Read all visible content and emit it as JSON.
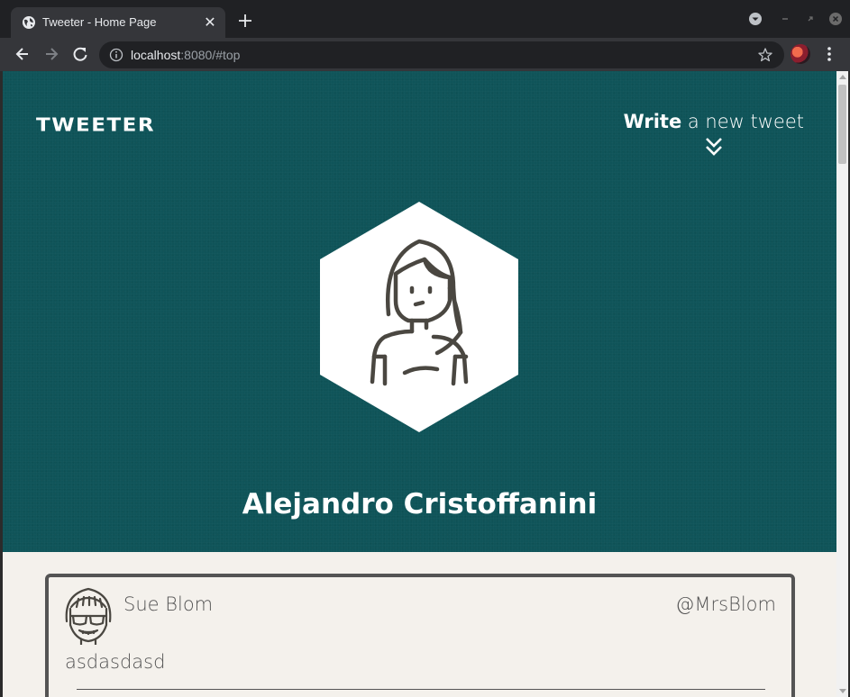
{
  "browser": {
    "tab_title": "Tweeter - Home Page",
    "url_host": "localhost",
    "url_rest": ":8080/#top"
  },
  "header": {
    "logo": "TWEETER",
    "compose_bold": "Write",
    "compose_rest": " a new tweet"
  },
  "profile": {
    "name": "Alejandro Cristoffanini"
  },
  "tweets": [
    {
      "name": "Sue Blom",
      "handle": "@MrsBlom",
      "text": "asdasdasd"
    }
  ],
  "colors": {
    "hero_bg": "#0f5459",
    "page_bg": "#f4f1ec",
    "text_dark": "#545454",
    "chrome_dark": "#202124",
    "chrome_tab": "#35363a"
  },
  "icons": {
    "tab": "globe-icon",
    "compose": "double-chevron-down-icon",
    "avatar": "woman-avatar-icon"
  }
}
